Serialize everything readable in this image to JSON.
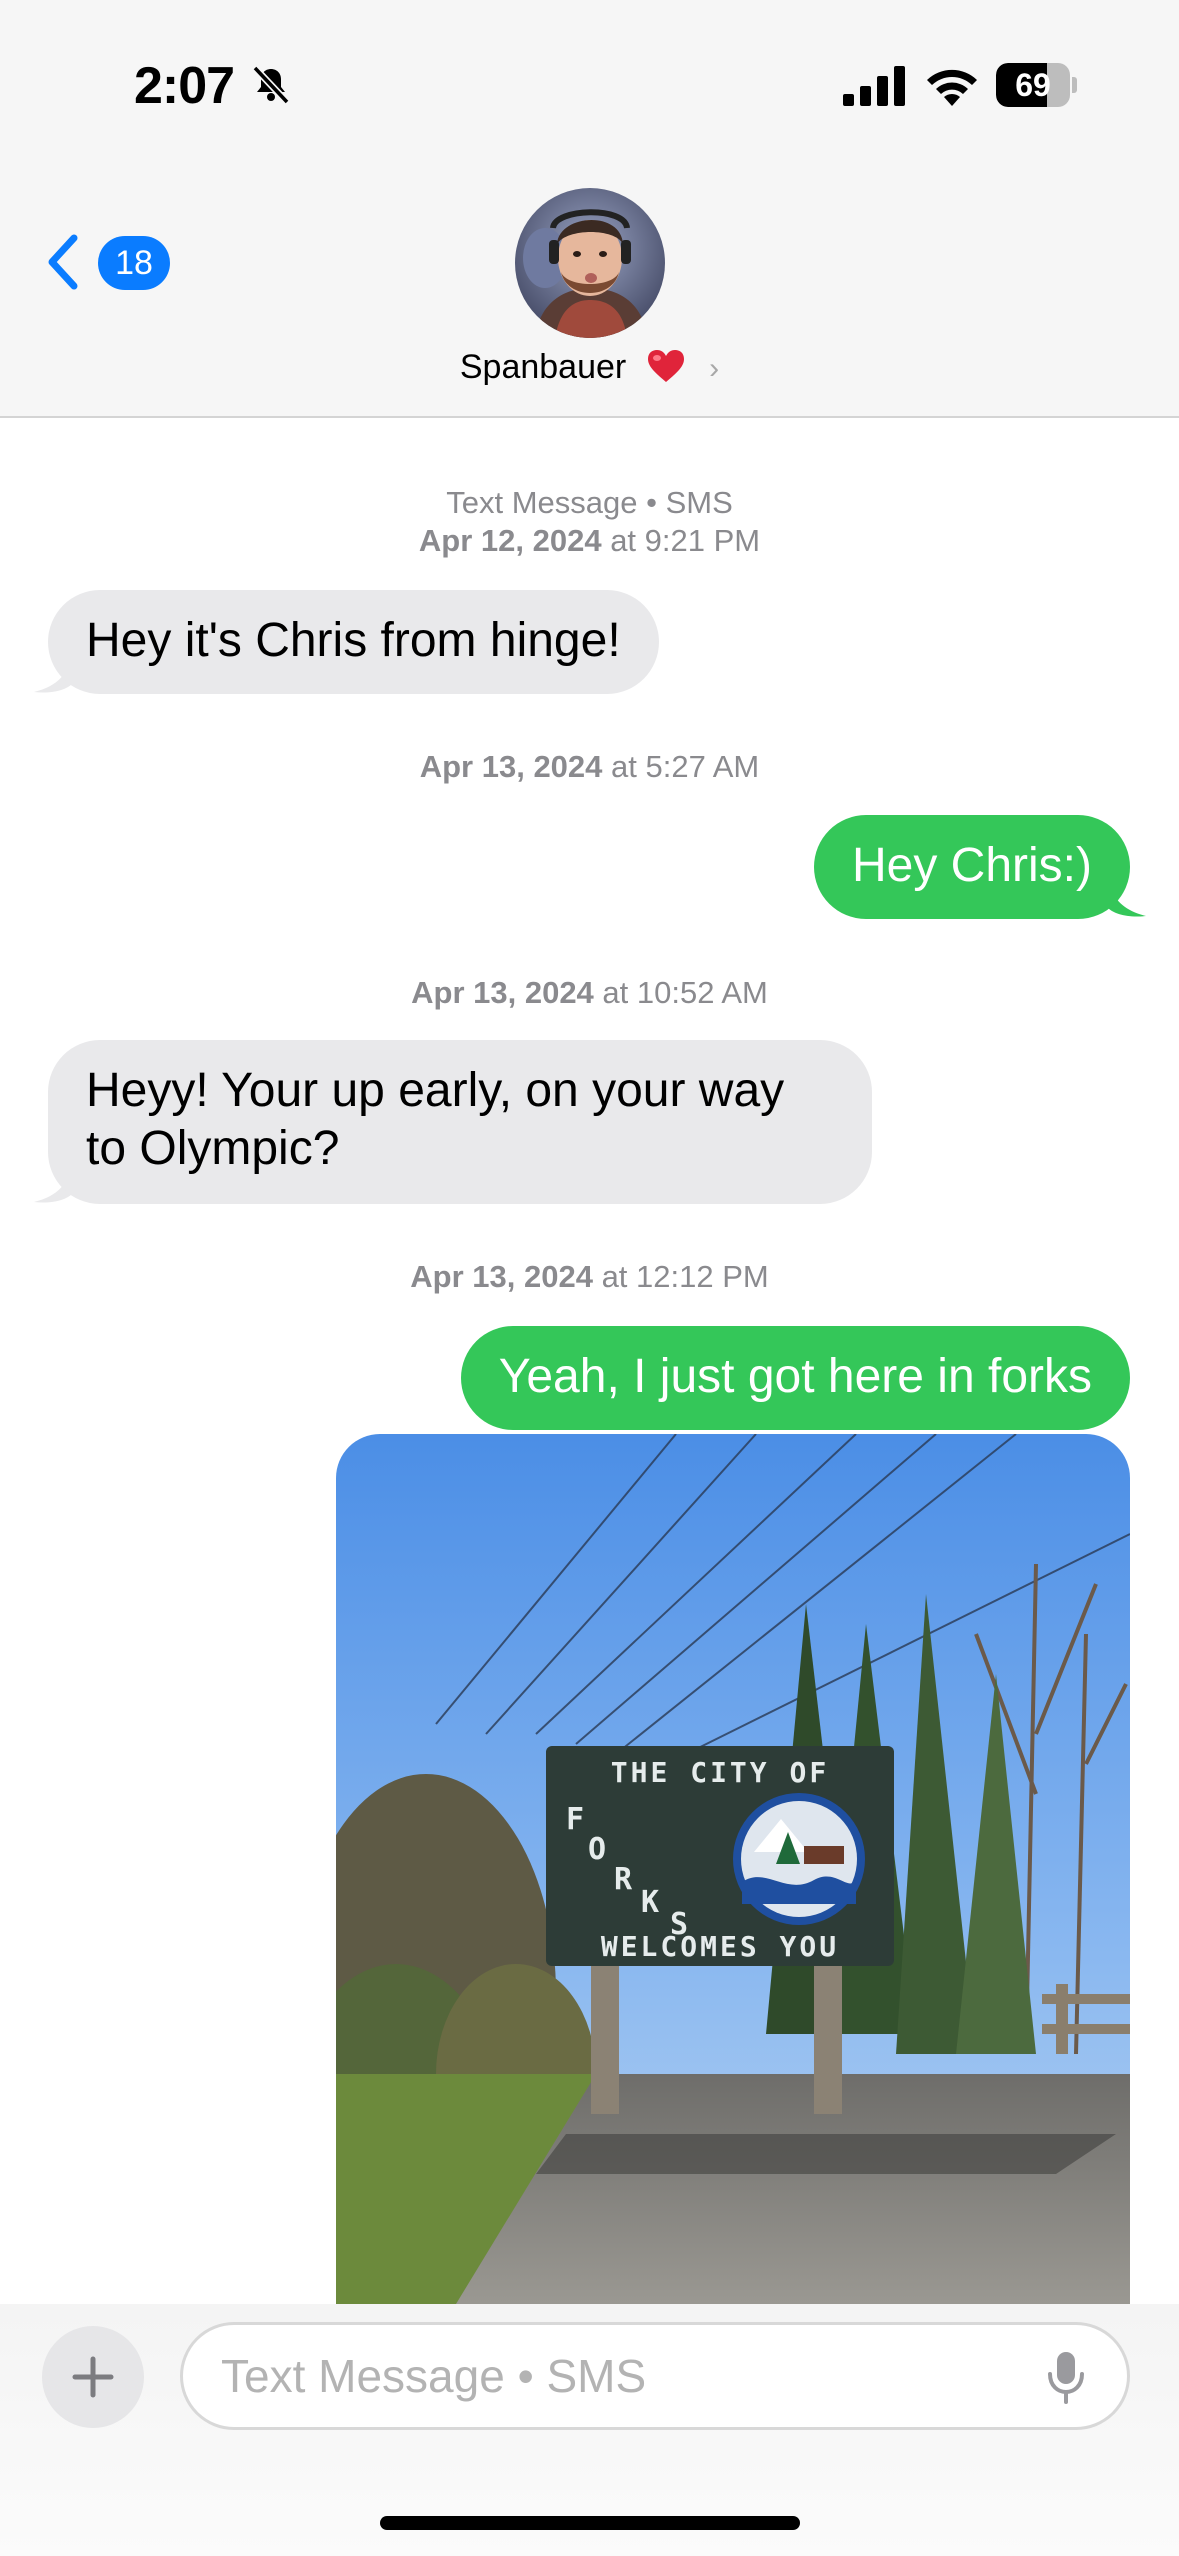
{
  "status_bar": {
    "time": "2:07",
    "battery_percent": "69",
    "battery_level": 0.69
  },
  "header": {
    "back_badge_count": "18",
    "contact_name": "Spanbauer",
    "contact_icon": "heart-emoji"
  },
  "conversation": {
    "service_label": "Text Message • SMS",
    "messages": [
      {
        "timestamp_date": "Apr 12, 2024",
        "timestamp_time": "at 9:21 PM",
        "direction": "received",
        "text": "Hey it's Chris from hinge!"
      },
      {
        "timestamp_date": "Apr 13, 2024",
        "timestamp_time": "at 5:27 AM",
        "direction": "sent",
        "text": "Hey Chris:)"
      },
      {
        "timestamp_date": "Apr 13, 2024",
        "timestamp_time": "at 10:52 AM",
        "direction": "received",
        "text_line1": "Heyy! Your up early, on your way",
        "text_line2": "to Olympic?"
      },
      {
        "timestamp_date": "Apr 13, 2024",
        "timestamp_time": "at 12:12 PM",
        "direction": "sent",
        "text": "Yeah, I just got here in forks"
      }
    ],
    "photo": {
      "sign_line1": "THE CITY OF",
      "sign_letters": [
        "F",
        "O",
        "R",
        "K",
        "S"
      ],
      "sign_line3": "WELCOMES YOU"
    }
  },
  "input_bar": {
    "placeholder": "Text Message • SMS",
    "value": "",
    "left_icon": "plus-icon",
    "right_icon": "microphone-icon"
  },
  "colors": {
    "sent_bubble": "#34c759",
    "received_bubble": "#e9e9eb",
    "accent_blue": "#0a7cff",
    "meta_gray": "#8a8a8e"
  }
}
